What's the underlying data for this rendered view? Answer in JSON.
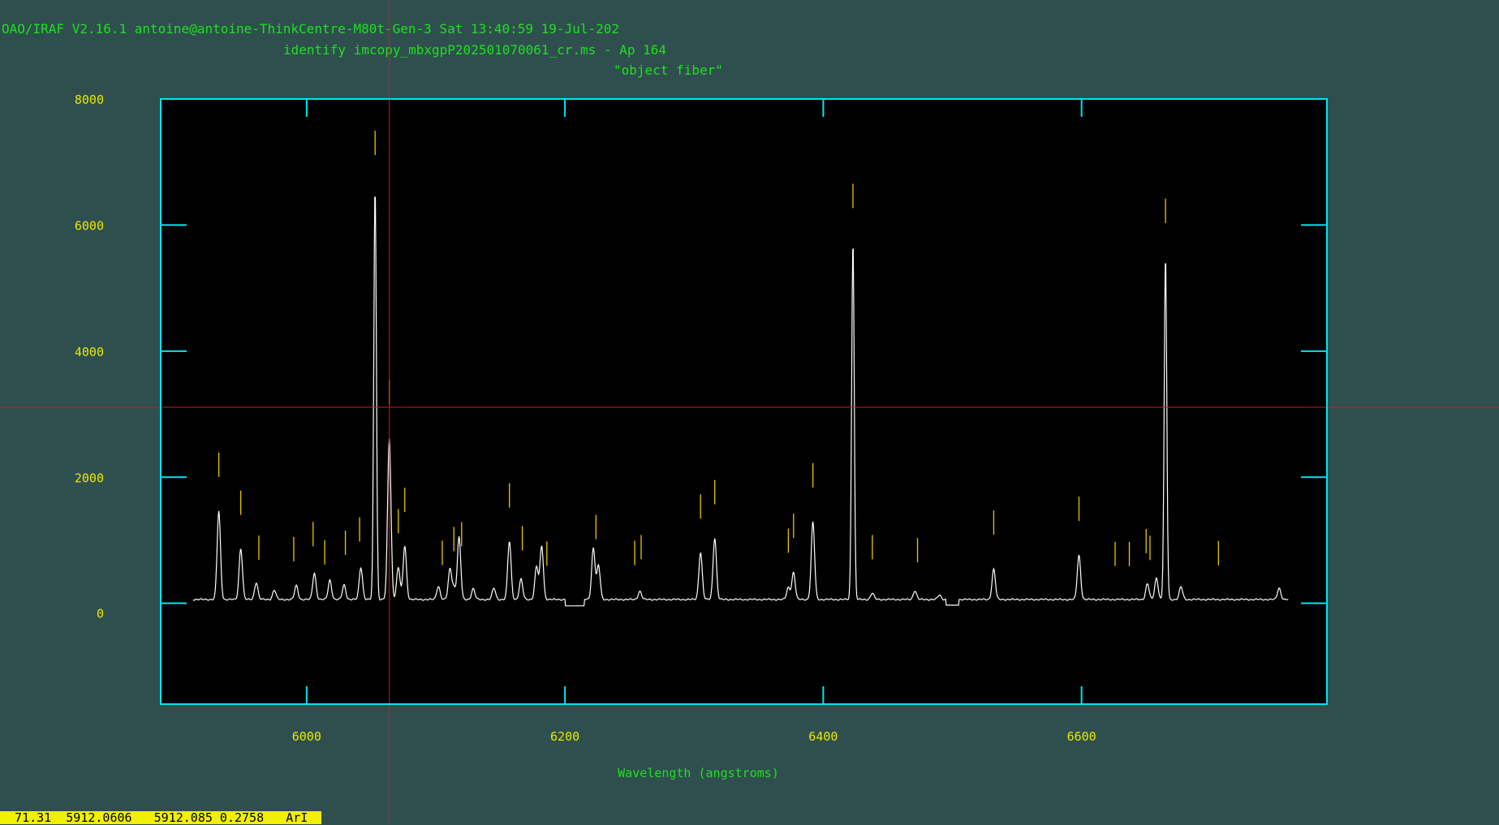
{
  "header": {
    "system_line": "OAO/IRAF V2.16.1 antoine@antoine-ThinkCentre-M80t-Gen-3 Sat 13:40:59 19-Jul-202",
    "command_line": "identify imcopy_mbxgpP202501070061_cr.ms - Ap 164",
    "subtitle": "\"object fiber\""
  },
  "status_bar": {
    "text": "  71.31  5912.0606   5912.085 0.2758   ArI"
  },
  "colors": {
    "background": "#2f4f4f",
    "plot_background": "#000000",
    "frame": "#00e5ee",
    "tick_labels": "#e8e800",
    "text": "#1ee01e",
    "spectrum": "#ffffff",
    "line_marks": "#e8c800",
    "cursor": "#c81e1e",
    "status_bg": "#f0f000"
  },
  "chart_data": {
    "type": "line",
    "title": "\"object fiber\"",
    "xlabel": "Wavelength (angstroms)",
    "ylabel": "",
    "xlim": [
      5887,
      6790
    ],
    "ylim": [
      -1600,
      8000
    ],
    "x_ticks": [
      6000,
      6200,
      6400,
      6600
    ],
    "x_tick_labels": [
      "6000",
      "6200",
      "6400",
      "6600"
    ],
    "y_ticks": [
      0,
      2000,
      4000,
      6000,
      8000
    ],
    "y_tick_labels": [
      "0",
      "2000",
      "4000",
      "6000",
      "8000"
    ],
    "continuum_level": 60,
    "x_start": 5912,
    "x_end": 6760,
    "depressions": [
      {
        "x": [
          6200,
          6215
        ],
        "y": -40
      },
      {
        "x": [
          6495,
          6505
        ],
        "y": -30
      }
    ],
    "peaks": [
      {
        "x": 5932,
        "y": 1400
      },
      {
        "x": 5949,
        "y": 810
      },
      {
        "x": 5961,
        "y": 270
      },
      {
        "x": 5975,
        "y": 150
      },
      {
        "x": 5992,
        "y": 220
      },
      {
        "x": 6006,
        "y": 420
      },
      {
        "x": 6018,
        "y": 310
      },
      {
        "x": 6029,
        "y": 230
      },
      {
        "x": 6042,
        "y": 510
      },
      {
        "x": 6053,
        "y": 6520
      },
      {
        "x": 6064,
        "y": 2560
      },
      {
        "x": 6071,
        "y": 510
      },
      {
        "x": 6076,
        "y": 850
      },
      {
        "x": 6102,
        "y": 210
      },
      {
        "x": 6111,
        "y": 480
      },
      {
        "x": 6114,
        "y": 180
      },
      {
        "x": 6118,
        "y": 990
      },
      {
        "x": 6129,
        "y": 170
      },
      {
        "x": 6145,
        "y": 180
      },
      {
        "x": 6157,
        "y": 920
      },
      {
        "x": 6166,
        "y": 320
      },
      {
        "x": 6178,
        "y": 520
      },
      {
        "x": 6182,
        "y": 850
      },
      {
        "x": 6222,
        "y": 820
      },
      {
        "x": 6226,
        "y": 540
      },
      {
        "x": 6258,
        "y": 130
      },
      {
        "x": 6305,
        "y": 750
      },
      {
        "x": 6316,
        "y": 980
      },
      {
        "x": 6373,
        "y": 190
      },
      {
        "x": 6377,
        "y": 430
      },
      {
        "x": 6392,
        "y": 1230
      },
      {
        "x": 6423,
        "y": 5680
      },
      {
        "x": 6438,
        "y": 100
      },
      {
        "x": 6471,
        "y": 140
      },
      {
        "x": 6490,
        "y": 70
      },
      {
        "x": 6532,
        "y": 480
      },
      {
        "x": 6598,
        "y": 700
      },
      {
        "x": 6651,
        "y": 250
      },
      {
        "x": 6658,
        "y": 340
      },
      {
        "x": 6665,
        "y": 5420
      },
      {
        "x": 6677,
        "y": 200
      },
      {
        "x": 6753,
        "y": 180
      }
    ],
    "line_marks": [
      5932,
      5949,
      5963,
      5990,
      6005,
      6014,
      6030,
      6041,
      6053,
      6064,
      6071,
      6076,
      6105,
      6114,
      6120,
      6157,
      6167,
      6186,
      6224,
      6254,
      6259,
      6305,
      6316,
      6373,
      6377,
      6392,
      6423,
      6438,
      6473,
      6532,
      6598,
      6626,
      6637,
      6650,
      6653,
      6665,
      6706
    ],
    "cursor": {
      "x": 6064,
      "y": 3110
    }
  }
}
